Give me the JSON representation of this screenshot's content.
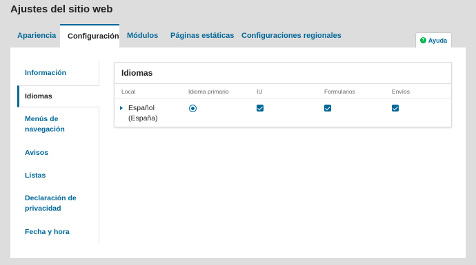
{
  "page": {
    "title": "Ajustes del sitio web"
  },
  "tabs": [
    {
      "label": "Apariencia"
    },
    {
      "label": "Configuración"
    },
    {
      "label": "Módulos"
    },
    {
      "label": "Páginas estáticas"
    },
    {
      "label": "Configuraciones regionales"
    }
  ],
  "active_tab": "Configuración",
  "help": {
    "label": "Ayuda",
    "icon": "help-icon"
  },
  "sidebar": {
    "items": [
      {
        "label": "Información"
      },
      {
        "label": "Idiomas"
      },
      {
        "label": "Menús de navegación"
      },
      {
        "label": "Avisos"
      },
      {
        "label": "Listas"
      },
      {
        "label": "Declaración de privacidad"
      },
      {
        "label": "Fecha y hora"
      }
    ],
    "active": "Idiomas"
  },
  "languages": {
    "title": "Idiomas",
    "columns": [
      "Local",
      "Idioma primario",
      "IU",
      "Formularios",
      "Envíos"
    ],
    "rows": [
      {
        "locale": "Español (España)",
        "primary": true,
        "ui": true,
        "forms": true,
        "submissions": true
      }
    ]
  },
  "colors": {
    "accent": "#006798",
    "help_icon": "#00b24e",
    "background": "#dddddd"
  }
}
